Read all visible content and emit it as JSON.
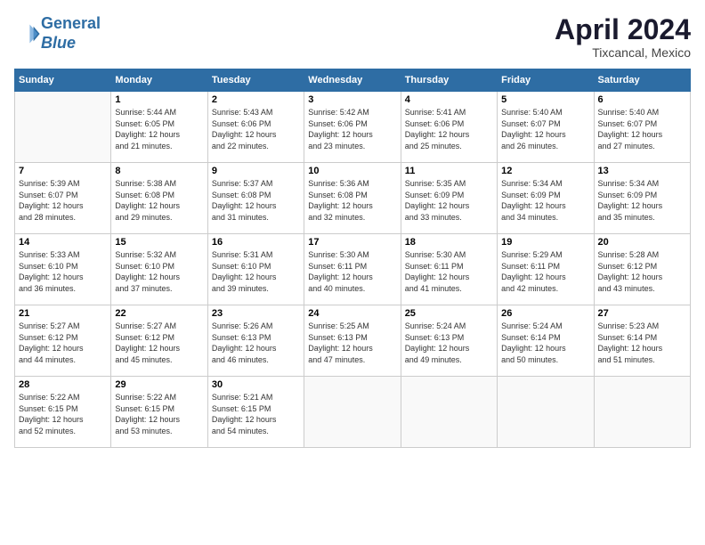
{
  "header": {
    "logo_line1": "General",
    "logo_line2": "Blue",
    "title": "April 2024",
    "location": "Tixcancal, Mexico"
  },
  "days_of_week": [
    "Sunday",
    "Monday",
    "Tuesday",
    "Wednesday",
    "Thursday",
    "Friday",
    "Saturday"
  ],
  "weeks": [
    [
      {
        "day": "",
        "info": ""
      },
      {
        "day": "1",
        "info": "Sunrise: 5:44 AM\nSunset: 6:05 PM\nDaylight: 12 hours\nand 21 minutes."
      },
      {
        "day": "2",
        "info": "Sunrise: 5:43 AM\nSunset: 6:06 PM\nDaylight: 12 hours\nand 22 minutes."
      },
      {
        "day": "3",
        "info": "Sunrise: 5:42 AM\nSunset: 6:06 PM\nDaylight: 12 hours\nand 23 minutes."
      },
      {
        "day": "4",
        "info": "Sunrise: 5:41 AM\nSunset: 6:06 PM\nDaylight: 12 hours\nand 25 minutes."
      },
      {
        "day": "5",
        "info": "Sunrise: 5:40 AM\nSunset: 6:07 PM\nDaylight: 12 hours\nand 26 minutes."
      },
      {
        "day": "6",
        "info": "Sunrise: 5:40 AM\nSunset: 6:07 PM\nDaylight: 12 hours\nand 27 minutes."
      }
    ],
    [
      {
        "day": "7",
        "info": "Sunrise: 5:39 AM\nSunset: 6:07 PM\nDaylight: 12 hours\nand 28 minutes."
      },
      {
        "day": "8",
        "info": "Sunrise: 5:38 AM\nSunset: 6:08 PM\nDaylight: 12 hours\nand 29 minutes."
      },
      {
        "day": "9",
        "info": "Sunrise: 5:37 AM\nSunset: 6:08 PM\nDaylight: 12 hours\nand 31 minutes."
      },
      {
        "day": "10",
        "info": "Sunrise: 5:36 AM\nSunset: 6:08 PM\nDaylight: 12 hours\nand 32 minutes."
      },
      {
        "day": "11",
        "info": "Sunrise: 5:35 AM\nSunset: 6:09 PM\nDaylight: 12 hours\nand 33 minutes."
      },
      {
        "day": "12",
        "info": "Sunrise: 5:34 AM\nSunset: 6:09 PM\nDaylight: 12 hours\nand 34 minutes."
      },
      {
        "day": "13",
        "info": "Sunrise: 5:34 AM\nSunset: 6:09 PM\nDaylight: 12 hours\nand 35 minutes."
      }
    ],
    [
      {
        "day": "14",
        "info": "Sunrise: 5:33 AM\nSunset: 6:10 PM\nDaylight: 12 hours\nand 36 minutes."
      },
      {
        "day": "15",
        "info": "Sunrise: 5:32 AM\nSunset: 6:10 PM\nDaylight: 12 hours\nand 37 minutes."
      },
      {
        "day": "16",
        "info": "Sunrise: 5:31 AM\nSunset: 6:10 PM\nDaylight: 12 hours\nand 39 minutes."
      },
      {
        "day": "17",
        "info": "Sunrise: 5:30 AM\nSunset: 6:11 PM\nDaylight: 12 hours\nand 40 minutes."
      },
      {
        "day": "18",
        "info": "Sunrise: 5:30 AM\nSunset: 6:11 PM\nDaylight: 12 hours\nand 41 minutes."
      },
      {
        "day": "19",
        "info": "Sunrise: 5:29 AM\nSunset: 6:11 PM\nDaylight: 12 hours\nand 42 minutes."
      },
      {
        "day": "20",
        "info": "Sunrise: 5:28 AM\nSunset: 6:12 PM\nDaylight: 12 hours\nand 43 minutes."
      }
    ],
    [
      {
        "day": "21",
        "info": "Sunrise: 5:27 AM\nSunset: 6:12 PM\nDaylight: 12 hours\nand 44 minutes."
      },
      {
        "day": "22",
        "info": "Sunrise: 5:27 AM\nSunset: 6:12 PM\nDaylight: 12 hours\nand 45 minutes."
      },
      {
        "day": "23",
        "info": "Sunrise: 5:26 AM\nSunset: 6:13 PM\nDaylight: 12 hours\nand 46 minutes."
      },
      {
        "day": "24",
        "info": "Sunrise: 5:25 AM\nSunset: 6:13 PM\nDaylight: 12 hours\nand 47 minutes."
      },
      {
        "day": "25",
        "info": "Sunrise: 5:24 AM\nSunset: 6:13 PM\nDaylight: 12 hours\nand 49 minutes."
      },
      {
        "day": "26",
        "info": "Sunrise: 5:24 AM\nSunset: 6:14 PM\nDaylight: 12 hours\nand 50 minutes."
      },
      {
        "day": "27",
        "info": "Sunrise: 5:23 AM\nSunset: 6:14 PM\nDaylight: 12 hours\nand 51 minutes."
      }
    ],
    [
      {
        "day": "28",
        "info": "Sunrise: 5:22 AM\nSunset: 6:15 PM\nDaylight: 12 hours\nand 52 minutes."
      },
      {
        "day": "29",
        "info": "Sunrise: 5:22 AM\nSunset: 6:15 PM\nDaylight: 12 hours\nand 53 minutes."
      },
      {
        "day": "30",
        "info": "Sunrise: 5:21 AM\nSunset: 6:15 PM\nDaylight: 12 hours\nand 54 minutes."
      },
      {
        "day": "",
        "info": ""
      },
      {
        "day": "",
        "info": ""
      },
      {
        "day": "",
        "info": ""
      },
      {
        "day": "",
        "info": ""
      }
    ]
  ]
}
